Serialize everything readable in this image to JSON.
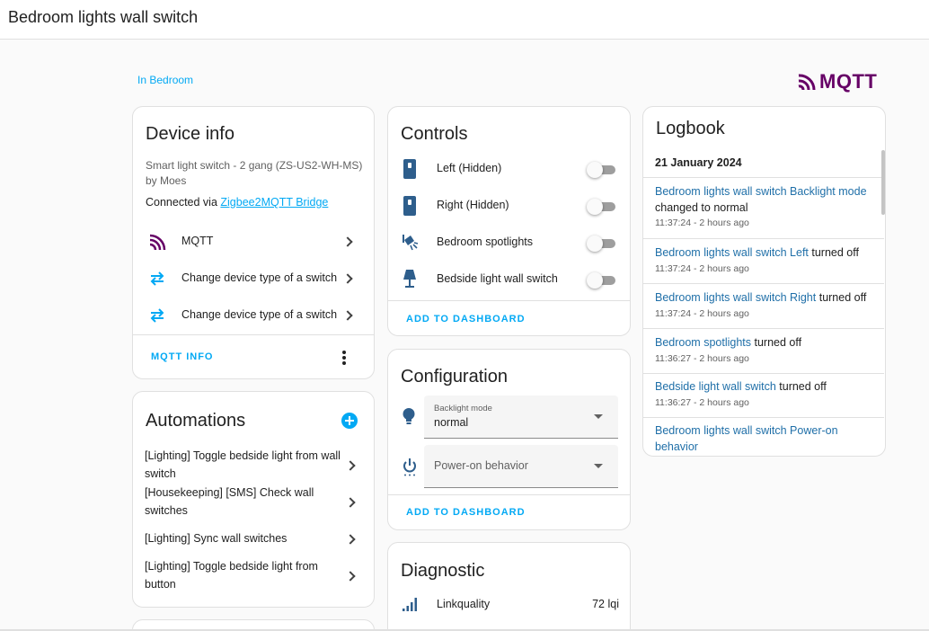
{
  "header": {
    "title": "Bedroom lights wall switch"
  },
  "area": {
    "label": "In Bedroom"
  },
  "brand": {
    "logo_text": "MQTT",
    "logo_color": "#660066",
    "accent": "#03a9f4"
  },
  "device_info": {
    "title": "Device info",
    "model": "Smart light switch - 2 gang (ZS-US2-WH-MS)",
    "manufacturer": "by Moes",
    "connected_prefix": "Connected via ",
    "connected_link": "Zigbee2MQTT Bridge",
    "items": [
      {
        "label": "MQTT",
        "icon": "mqtt-icon"
      },
      {
        "label": "Change device type of a switch",
        "icon": "swap-horizontal-icon"
      },
      {
        "label": "Change device type of a switch",
        "icon": "swap-horizontal-icon"
      }
    ],
    "action": "MQTT INFO"
  },
  "automations": {
    "title": "Automations",
    "items": [
      "[Lighting] Toggle bedside light from wall switch",
      "[Housekeeping] [SMS] Check wall switches",
      "[Lighting] Sync wall switches",
      "[Lighting] Toggle bedside light from button"
    ]
  },
  "controls": {
    "title": "Controls",
    "items": [
      {
        "label": "Left (Hidden)",
        "icon": "light-switch-icon",
        "state": "off"
      },
      {
        "label": "Right (Hidden)",
        "icon": "light-switch-icon",
        "state": "off"
      },
      {
        "label": "Bedroom spotlights",
        "icon": "spotlight-icon",
        "state": "off"
      },
      {
        "label": "Bedside light wall switch",
        "icon": "lamp-icon",
        "state": "off"
      }
    ],
    "action": "ADD TO DASHBOARD"
  },
  "configuration": {
    "title": "Configuration",
    "backlight": {
      "label": "Backlight mode",
      "value": "normal"
    },
    "power_on": {
      "placeholder": "Power-on behavior"
    },
    "action": "ADD TO DASHBOARD"
  },
  "diagnostic": {
    "title": "Diagnostic",
    "items": [
      {
        "label": "Linkquality",
        "value": "72 lqi"
      }
    ]
  },
  "logbook": {
    "title": "Logbook",
    "date": "21 January 2024",
    "entries": [
      {
        "link": "Bedroom lights wall switch Backlight mode",
        "text": " changed to normal",
        "time": "11:37:24 - 2 hours ago"
      },
      {
        "link": "Bedroom lights wall switch Left",
        "text": " turned off",
        "time": "11:37:24 - 2 hours ago"
      },
      {
        "link": "Bedroom lights wall switch Right",
        "text": " turned off",
        "time": "11:37:24 - 2 hours ago"
      },
      {
        "link": "Bedroom spotlights",
        "text": " turned off",
        "time": "11:36:27 - 2 hours ago"
      },
      {
        "link": "Bedside light wall switch",
        "text": " turned off",
        "time": "11:36:27 - 2 hours ago"
      },
      {
        "link": "Bedroom lights wall switch Power-on behavior",
        "text": "",
        "time": ""
      }
    ]
  }
}
